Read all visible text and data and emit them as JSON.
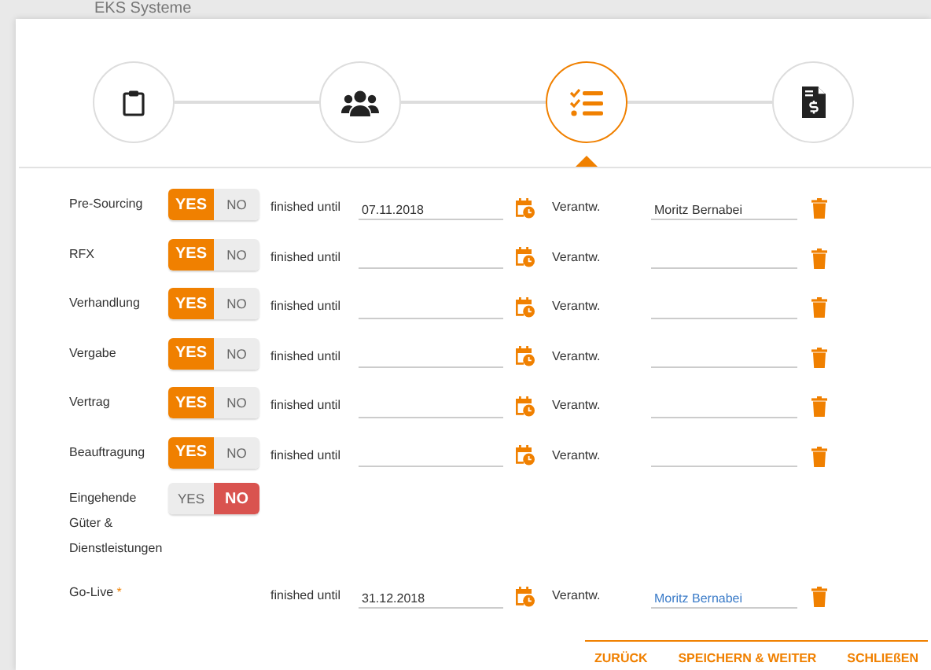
{
  "background": {
    "title": "EKS Systeme"
  },
  "steps": [
    {
      "kind": "clipboard",
      "selected": false
    },
    {
      "kind": "users",
      "selected": false
    },
    {
      "kind": "checklist",
      "selected": true
    },
    {
      "kind": "invoice",
      "selected": false
    }
  ],
  "rows": [
    {
      "kind": "phase",
      "label": "Pre-Sourcing",
      "toggle": [
        {
          "label": "YES",
          "kind": "yes",
          "selected": true
        },
        {
          "label": "NO",
          "kind": "no",
          "selected": false
        }
      ],
      "date_label": "finished until",
      "date": "07.11.2018",
      "responsible_label": "Verantw.",
      "responsible": "Moritz Bernabei",
      "linked": false
    },
    {
      "kind": "phase",
      "label": "RFX",
      "toggle": [
        {
          "label": "YES",
          "kind": "yes",
          "selected": true
        },
        {
          "label": "NO",
          "kind": "no",
          "selected": false
        }
      ],
      "date_label": "finished until",
      "responsible_label": "Verantw.",
      "linked": false
    },
    {
      "kind": "phase",
      "label": "Verhandlung",
      "toggle": [
        {
          "label": "YES",
          "kind": "yes",
          "selected": true
        },
        {
          "label": "NO",
          "kind": "no",
          "selected": false
        }
      ],
      "date_label": "finished until",
      "responsible_label": "Verantw.",
      "linked": false
    },
    {
      "kind": "phase",
      "label": "Vergabe",
      "toggle": [
        {
          "label": "YES",
          "kind": "yes",
          "selected": true
        },
        {
          "label": "NO",
          "kind": "no",
          "selected": false
        }
      ],
      "date_label": "finished until",
      "responsible_label": "Verantw.",
      "linked": false
    },
    {
      "kind": "phase",
      "label": "Vertrag",
      "toggle": [
        {
          "label": "YES",
          "kind": "yes",
          "selected": true
        },
        {
          "label": "NO",
          "kind": "no",
          "selected": false
        }
      ],
      "date_label": "finished until",
      "responsible_label": "Verantw.",
      "linked": false
    },
    {
      "kind": "phase",
      "label": "Beauftragung",
      "toggle": [
        {
          "label": "YES",
          "kind": "yes",
          "selected": true
        },
        {
          "label": "NO",
          "kind": "no",
          "selected": false
        }
      ],
      "date_label": "finished until",
      "responsible_label": "Verantw.",
      "linked": false
    },
    {
      "kind": "toggle",
      "label": "Eingehende Güter & Dienstleistungen",
      "toggle": [
        {
          "label": "YES",
          "kind": "yes",
          "selected": false
        },
        {
          "label": "NO",
          "kind": "no",
          "selected": true
        }
      ]
    },
    {
      "kind": "phase",
      "label": "Go-Live",
      "required_mark": "*",
      "date_label": "finished until",
      "date": "31.12.2018",
      "responsible_label": "Verantw.",
      "responsible": "Moritz Bernabei",
      "linked": true
    }
  ],
  "footer": {
    "buttons": [
      "ZURÜCK",
      "SPEICHERN & WEITER",
      "SCHLIEßEN"
    ]
  }
}
